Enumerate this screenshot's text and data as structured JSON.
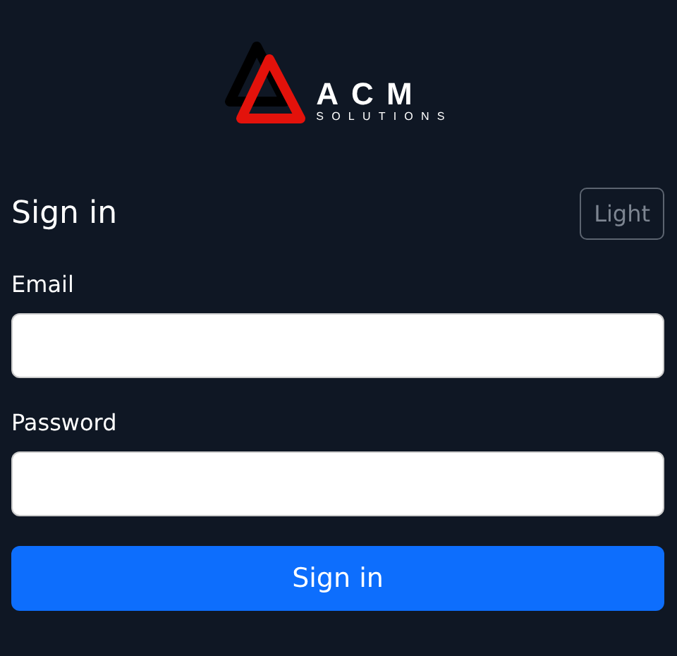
{
  "logo": {
    "name": "ACM",
    "tagline": "SOLUTIONS"
  },
  "heading": "Sign in",
  "theme_toggle": {
    "label": "Light"
  },
  "fields": [
    {
      "label": "Email"
    },
    {
      "label": "Password"
    }
  ],
  "submit": {
    "label": "Sign in"
  }
}
